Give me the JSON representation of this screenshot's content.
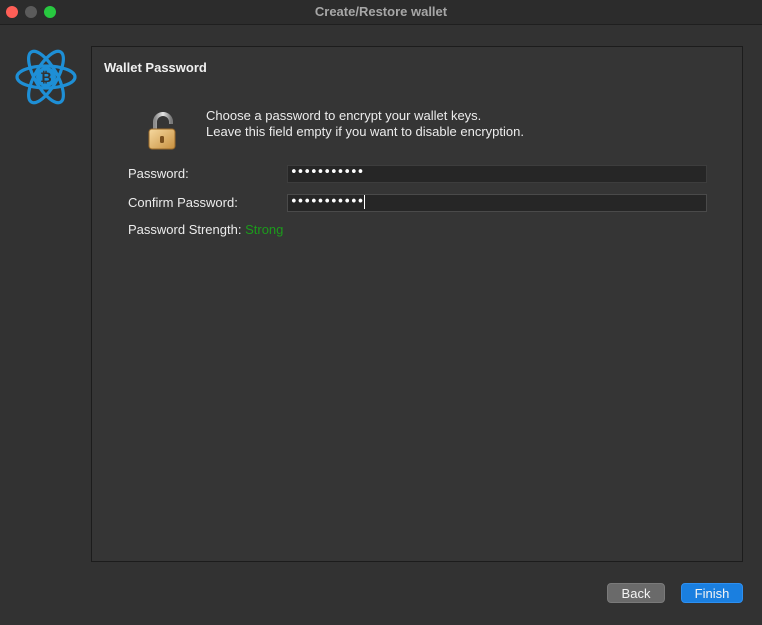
{
  "window": {
    "title": "Create/Restore wallet"
  },
  "panel": {
    "title": "Wallet Password",
    "message_line1": "Choose a password to encrypt your wallet keys.",
    "message_line2": "Leave this field empty if you want to disable encryption."
  },
  "form": {
    "password_label": "Password:",
    "password_value": "•••••••••••",
    "confirm_label": "Confirm Password:",
    "confirm_value": "•••••••••••",
    "strength_label": "Password Strength:",
    "strength_value": "Strong"
  },
  "buttons": {
    "back": "Back",
    "finish": "Finish"
  },
  "colors": {
    "accent": "#1a7fe0",
    "strength_strong": "#1c9b1c",
    "logo": "#1e8fd6"
  },
  "icons": {
    "logo": "electrum-bitcoin-logo-icon",
    "lock": "open-padlock-icon"
  }
}
